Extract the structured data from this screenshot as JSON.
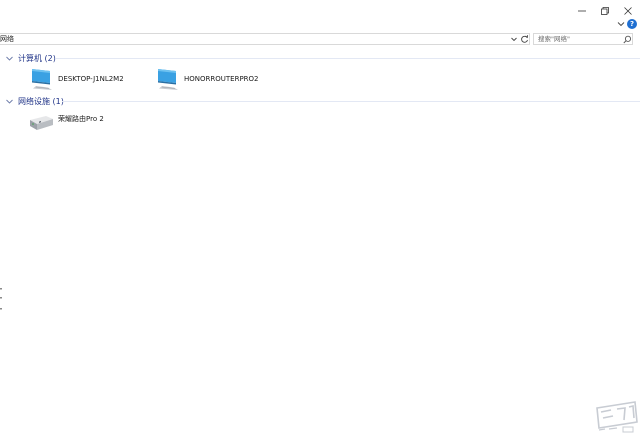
{
  "window": {
    "controls": {
      "minimize": "minimize",
      "maximize": "maximize",
      "close": "close"
    }
  },
  "ribbon": {
    "help_label": "?"
  },
  "address_bar": {
    "path": "网络"
  },
  "search": {
    "placeholder": "搜索\"网络\""
  },
  "groups": [
    {
      "header": "计算机 (2)",
      "items": [
        {
          "name": "DESKTOP-J1NL2M2"
        },
        {
          "name": "HONORROUTERPRO2"
        }
      ]
    },
    {
      "header": "网络设施 (1)",
      "items": [
        {
          "name": "荣耀路由Pro 2"
        }
      ]
    }
  ],
  "colors": {
    "accent": "#1e3287",
    "help_blue": "#1f6fd1",
    "pc_blue": "#3aa1e3"
  }
}
